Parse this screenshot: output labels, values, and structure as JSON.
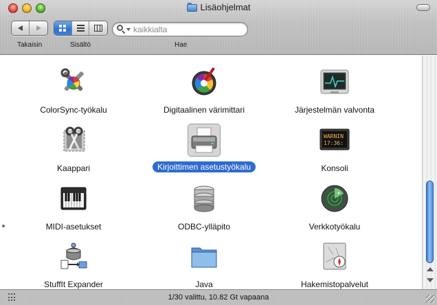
{
  "window": {
    "title": "Lisäohjelmat"
  },
  "toolbar": {
    "back_label": "Takaisin",
    "view_label": "Sisältö",
    "search_label": "Hae",
    "search_placeholder": "kaikkialta"
  },
  "items": [
    {
      "label": "ColorSync-työkalu",
      "icon": "colorsync-icon"
    },
    {
      "label": "Digitaalinen värimittari",
      "icon": "color-meter-icon"
    },
    {
      "label": "Järjestelmän valvonta",
      "icon": "activity-monitor-icon"
    },
    {
      "label": "Kaappari",
      "icon": "grab-icon"
    },
    {
      "label": "Kirjoittimen asetustyökalu",
      "icon": "printer-icon",
      "selected": true
    },
    {
      "label": "Konsoli",
      "icon": "console-icon"
    },
    {
      "label": "MIDI-asetukset",
      "icon": "midi-keyboard-icon"
    },
    {
      "label": "ODBC-ylläpito",
      "icon": "database-icon"
    },
    {
      "label": "Verkkotyökalu",
      "icon": "network-radar-icon"
    },
    {
      "label": "StuffIt Expander",
      "icon": "stuffit-icon"
    },
    {
      "label": "Java",
      "icon": "folder-icon"
    },
    {
      "label": "Hakemistopalvelut",
      "icon": "directory-compass-icon"
    }
  ],
  "console_icon_text": [
    "WARNIN",
    "17:36:"
  ],
  "status": {
    "text": "1/30 valittu, 10.82 Gt vapaana"
  },
  "colors": {
    "selection": "#2f6bd0",
    "scroll_thumb": "#4b8ad8"
  }
}
